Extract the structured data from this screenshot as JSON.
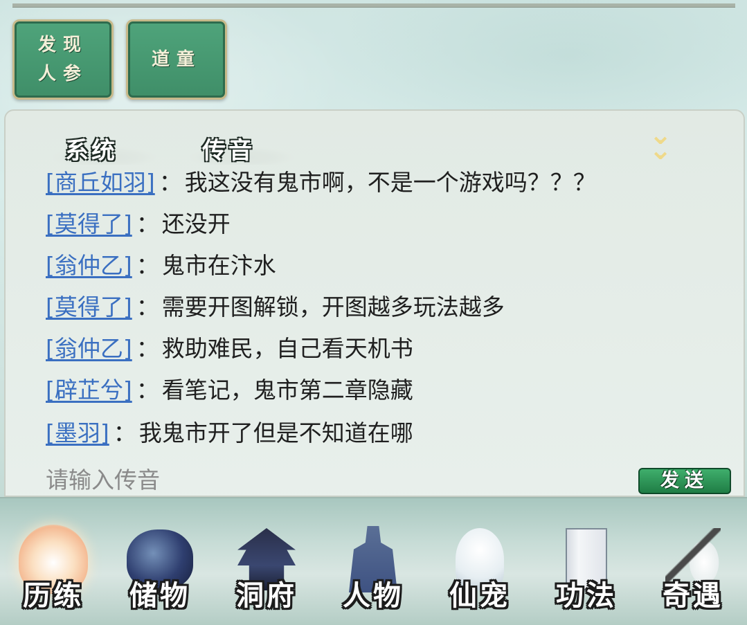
{
  "quest_buttons": [
    {
      "label_line1": "发现",
      "label_line2": "人参"
    },
    {
      "label_line1": "道童",
      "label_line2": ""
    }
  ],
  "chat": {
    "tabs": [
      "系统",
      "传音"
    ],
    "collapse_icon": "double-chevron-down-icon",
    "messages": [
      {
        "name": "[商丘如羽]",
        "text": "我这没有鬼市啊，不是一个游戏吗？？？"
      },
      {
        "name": "[莫得了]",
        "text": "还没开"
      },
      {
        "name": "[翁仲乙]",
        "text": "鬼市在汴水"
      },
      {
        "name": "[莫得了]",
        "text": "需要开图解锁，开图越多玩法越多"
      },
      {
        "name": "[翁仲乙]",
        "text": "救助难民，自己看天机书"
      },
      {
        "name": "[辟芷兮]",
        "text": "看笔记，鬼市第二章隐藏"
      },
      {
        "name": "[墨羽]",
        "text": "我鬼市开了但是不知道在哪"
      }
    ],
    "separator": "：",
    "input_placeholder": "请输入传音",
    "send_label": "发送"
  },
  "bottom_nav": [
    {
      "label": "历练",
      "icon": "mountain-icon",
      "active": true
    },
    {
      "label": "储物",
      "icon": "bag-icon",
      "active": false
    },
    {
      "label": "洞府",
      "icon": "pavilion-icon",
      "active": false
    },
    {
      "label": "人物",
      "icon": "person-icon",
      "active": false
    },
    {
      "label": "仙宠",
      "icon": "ghost-pet-icon",
      "active": false
    },
    {
      "label": "功法",
      "icon": "book-icon",
      "active": false
    },
    {
      "label": "奇遇",
      "icon": "brush-icon",
      "active": false
    }
  ],
  "colors": {
    "name_link": "#3a6fc1",
    "quest_button": "#4fa47b",
    "send_button": "#2a9556",
    "collapse_icon": "#efd98a"
  }
}
